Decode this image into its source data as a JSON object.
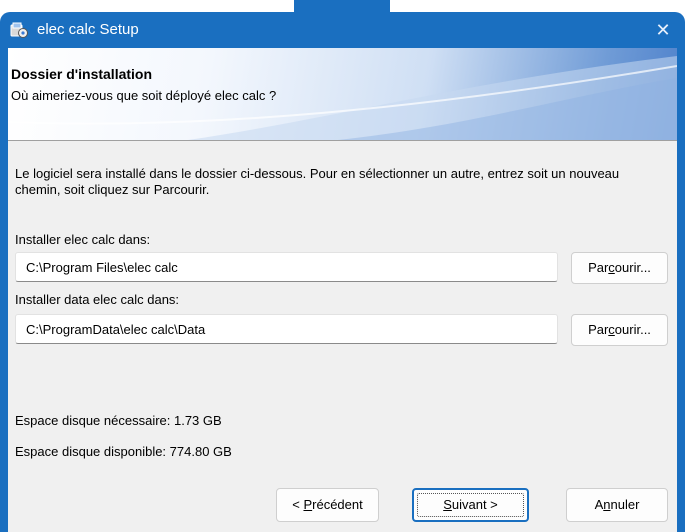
{
  "window": {
    "title": "elec calc Setup",
    "close_glyph": "✕",
    "accent_color": "#1a6fc0"
  },
  "header": {
    "title": "Dossier d'installation",
    "subtitle": "Où aimeriez-vous que soit déployé elec calc ?"
  },
  "body": {
    "description": "Le logiciel sera installé dans le dossier ci-dessous. Pour en sélectionner un autre, entrez soit un nouveau chemin, soit cliquez sur Parcourir.",
    "install_label": "Installer elec calc dans:",
    "install_path": "C:\\Program Files\\elec calc",
    "data_label": "Installer data elec calc dans:",
    "data_path": "C:\\ProgramData\\elec calc\\Data",
    "browse_pre": "Par",
    "browse_key": "c",
    "browse_post": "ourir...",
    "space_required": "Espace disque nécessaire: 1.73 GB",
    "space_available": "Espace disque disponible: 774.80 GB"
  },
  "buttons": {
    "back_pre": "< ",
    "back_key": "P",
    "back_post": "récédent",
    "next_key": "S",
    "next_post": "uivant >",
    "cancel_pre": "A",
    "cancel_key": "n",
    "cancel_post": "nuler"
  },
  "icons": {
    "app": "setup-package-icon",
    "close": "close-icon"
  }
}
